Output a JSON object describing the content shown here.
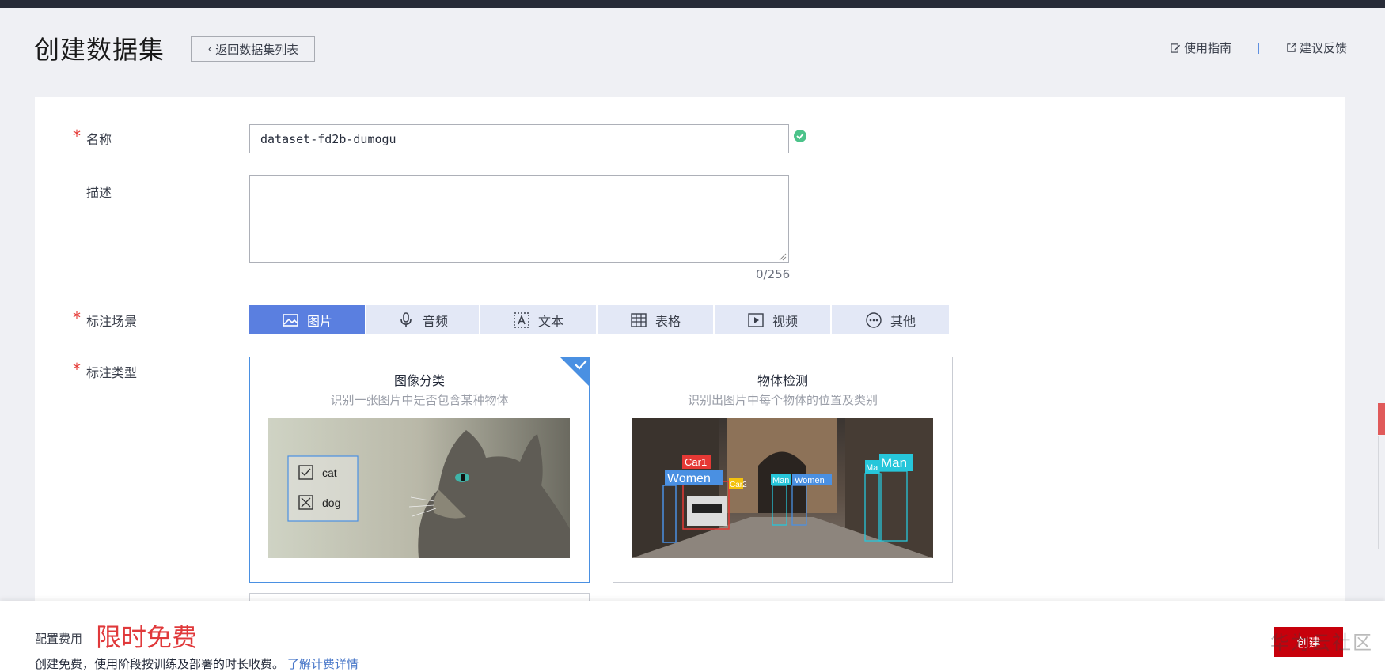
{
  "header": {
    "title": "创建数据集",
    "back_label": "返回数据集列表",
    "guide_label": "使用指南",
    "feedback_label": "建议反馈"
  },
  "form": {
    "name_label": "名称",
    "name_value": "dataset-fd2b-dumogu",
    "desc_label": "描述",
    "desc_value": "",
    "desc_counter": "0/256",
    "scene_label": "标注场景",
    "scene_tabs": [
      {
        "label": "图片",
        "icon": "image-icon",
        "active": true
      },
      {
        "label": "音频",
        "icon": "microphone-icon",
        "active": false
      },
      {
        "label": "文本",
        "icon": "text-icon",
        "active": false
      },
      {
        "label": "表格",
        "icon": "table-icon",
        "active": false
      },
      {
        "label": "视频",
        "icon": "video-icon",
        "active": false
      },
      {
        "label": "其他",
        "icon": "more-icon",
        "active": false
      }
    ],
    "type_label": "标注类型",
    "types": [
      {
        "title": "图像分类",
        "subtitle": "识别一张图片中是否包含某种物体",
        "selected": true,
        "image_labels": [
          "cat",
          "dog"
        ]
      },
      {
        "title": "物体检测",
        "subtitle": "识别出图片中每个物体的位置及类别",
        "selected": false,
        "image_labels": [
          "Car1",
          "Women",
          "Car2",
          "Man",
          "Women",
          "Ma",
          "Man"
        ]
      }
    ]
  },
  "footer": {
    "fee_label": "配置费用",
    "fee_value": "限时免费",
    "fee_desc": "创建免费，使用阶段按训练及部署的时长收费。",
    "fee_link": "了解计费详情",
    "create_label": "创建",
    "watermark": "华为云社区"
  },
  "colors": {
    "accent": "#5a7fe0",
    "danger": "#c7000b",
    "free_text": "#e0393b",
    "success": "#4cc38a"
  }
}
